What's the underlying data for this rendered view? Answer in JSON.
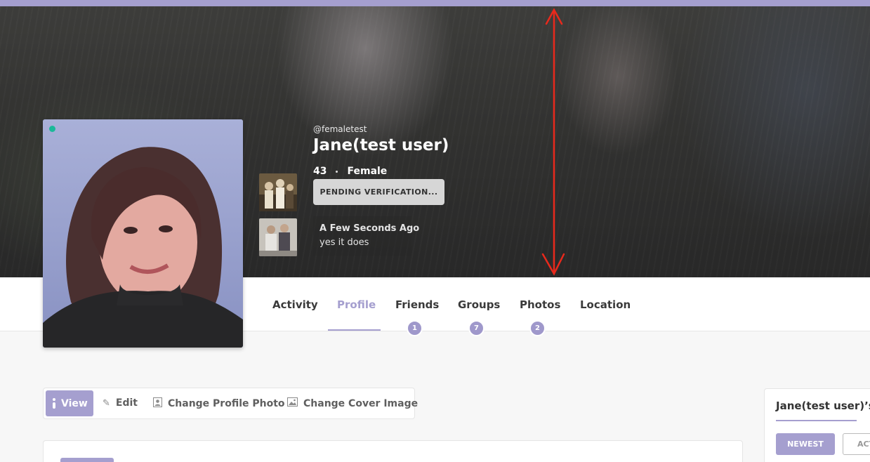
{
  "profile": {
    "handle": "@femaletest",
    "name": "Jane(test user)",
    "age": "43",
    "gender": "Female",
    "verification_status": "PENDING VERIFICATION..."
  },
  "latest_update": {
    "time": "A Few Seconds Ago",
    "text": "yes it does"
  },
  "nav": {
    "tabs": [
      {
        "label": "Activity"
      },
      {
        "label": "Profile",
        "active": true
      },
      {
        "label": "Friends",
        "count": "1"
      },
      {
        "label": "Groups",
        "count": "7"
      },
      {
        "label": "Photos",
        "count": "2"
      },
      {
        "label": "Location"
      }
    ]
  },
  "actions": {
    "view": "View",
    "edit": "Edit",
    "change_photo": "Change Profile Photo",
    "change_cover": "Change Cover Image"
  },
  "sidebar": {
    "title": "Jane(test user)’s",
    "newest": "NEWEST",
    "active": "ACT"
  },
  "colors": {
    "accent": "#a59fcf",
    "online": "#1bb999",
    "annotation": "#e8291c"
  },
  "icons": [
    "user-icon",
    "pencil-icon",
    "portrait-icon",
    "image-icon"
  ]
}
